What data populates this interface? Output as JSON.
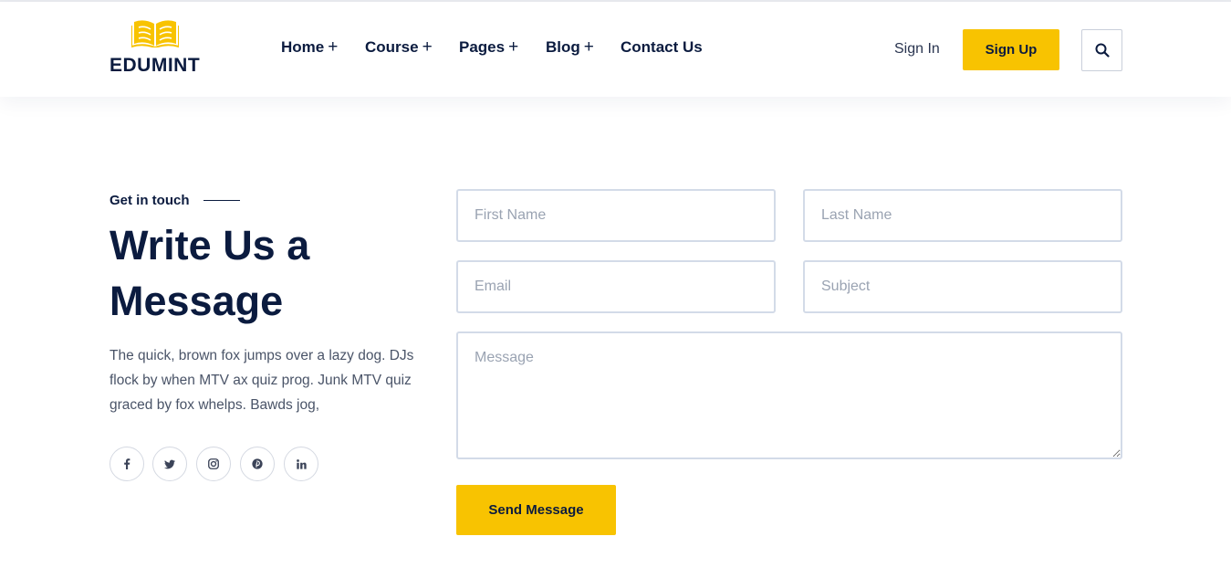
{
  "brand": {
    "name": "EDUMINT",
    "logo_icon": "open-book-icon",
    "accent_color": "#f8c301",
    "text_color": "#0b1b3f"
  },
  "nav": {
    "items": [
      {
        "label": "Home",
        "has_dropdown": true
      },
      {
        "label": "Course",
        "has_dropdown": true
      },
      {
        "label": "Pages",
        "has_dropdown": true
      },
      {
        "label": "Blog",
        "has_dropdown": true
      },
      {
        "label": "Contact Us",
        "has_dropdown": false
      }
    ],
    "dropdown_symbol": "+"
  },
  "header_actions": {
    "sign_in": "Sign In",
    "sign_up": "Sign Up",
    "search_icon": "search-icon"
  },
  "contact": {
    "eyebrow": "Get in touch",
    "heading": "Write Us a Message",
    "description": "The quick, brown fox jumps over a lazy dog. DJs flock by when MTV ax quiz prog. Junk MTV quiz graced by fox whelps. Bawds jog,",
    "socials": [
      "facebook-icon",
      "twitter-icon",
      "instagram-icon",
      "pinterest-icon",
      "linkedin-icon"
    ]
  },
  "form": {
    "first_name_placeholder": "First Name",
    "last_name_placeholder": "Last Name",
    "email_placeholder": "Email",
    "subject_placeholder": "Subject",
    "message_placeholder": "Message",
    "submit_label": "Send Message"
  }
}
